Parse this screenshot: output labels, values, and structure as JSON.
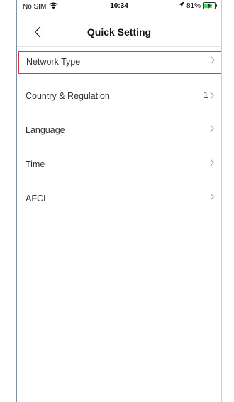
{
  "status_bar": {
    "carrier": "No SIM",
    "time": "10:34",
    "battery_percent": "81%",
    "battery_level": 0.81,
    "icons": [
      "wifi-icon",
      "location-arrow-icon",
      "battery-charging-icon"
    ]
  },
  "nav": {
    "title": "Quick Setting",
    "back_icon": "chevron-left-icon"
  },
  "menu": {
    "items": [
      {
        "label": "Network Type",
        "value": "",
        "highlighted": true
      },
      {
        "label": "Country & Regulation",
        "value": "1",
        "highlighted": false
      },
      {
        "label": "Language",
        "value": "",
        "highlighted": false
      },
      {
        "label": "Time",
        "value": "",
        "highlighted": false
      },
      {
        "label": "AFCI",
        "value": "",
        "highlighted": false
      }
    ]
  },
  "colors": {
    "highlight_border": "#d9363e",
    "battery_fill": "#4cd964",
    "chevron": "#9a9a9a"
  }
}
